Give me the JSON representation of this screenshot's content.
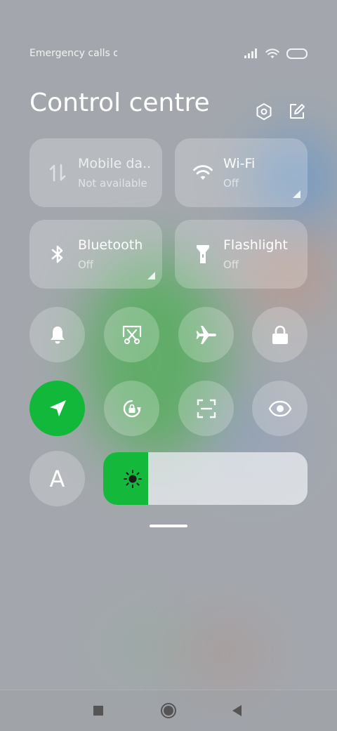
{
  "status": {
    "carrier_text": "Emergency calls o",
    "icons": [
      "signal-icon",
      "wifi-icon",
      "battery-icon"
    ]
  },
  "header": {
    "title": "Control centre",
    "icons": [
      "settings-icon",
      "edit-icon"
    ]
  },
  "tiles": [
    {
      "name": "Mobile da..",
      "status": "Not available",
      "icon": "mobile-data-icon"
    },
    {
      "name": "Wi-Fi",
      "status": "Off",
      "icon": "wifi-icon"
    },
    {
      "name": "Bluetooth",
      "status": "Off",
      "icon": "bluetooth-icon"
    },
    {
      "name": "Flashlight",
      "status": "Off",
      "icon": "flashlight-icon"
    }
  ],
  "toggles": [
    {
      "icon": "bell-icon",
      "active": false
    },
    {
      "icon": "screenshot-icon",
      "active": false
    },
    {
      "icon": "airplane-icon",
      "active": false
    },
    {
      "icon": "lock-icon",
      "active": false
    },
    {
      "icon": "location-icon",
      "active": true
    },
    {
      "icon": "rotation-lock-icon",
      "active": false
    },
    {
      "icon": "scan-icon",
      "active": false
    },
    {
      "icon": "eye-icon",
      "active": false
    },
    {
      "icon": "auto-brightness-icon",
      "label": "A",
      "active": false
    }
  ],
  "brightness": {
    "level": 0.22,
    "icon": "sun-icon"
  },
  "navbar": {
    "icons": [
      "recents-icon",
      "home-icon",
      "back-icon"
    ]
  },
  "colors": {
    "accent": "#12b83a",
    "text": "#ffffff"
  }
}
